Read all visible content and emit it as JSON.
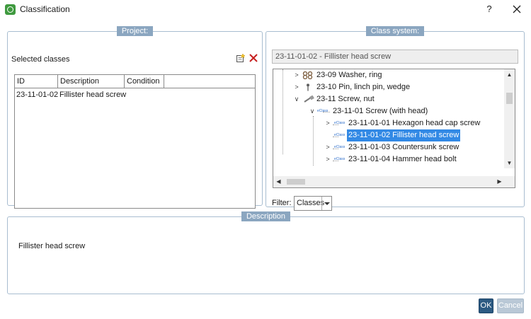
{
  "window": {
    "title": "Classification",
    "help_label": "?",
    "close_label": "close"
  },
  "project": {
    "legend": "Project:",
    "selected_classes_label": "Selected classes",
    "table": {
      "columns": [
        "ID",
        "Description",
        "Condition"
      ],
      "rows": [
        {
          "id": "23-11-01-02",
          "description": "Fillister head screw",
          "condition": ""
        }
      ]
    }
  },
  "class_system": {
    "legend": "Class system:",
    "current_path": "23-11-01-02 - Fillister head screw",
    "tree": [
      {
        "label": "23-09 Washer, ring",
        "icon": "washer-icon"
      },
      {
        "label": "23-10 Pin, linch pin, wedge",
        "icon": "pin-icon"
      },
      {
        "label": "23-11 Screw, nut",
        "icon": "screw-icon"
      },
      {
        "label": "23-11-01 Screw (with head)",
        "icon": "eclass-icon",
        "badge": "eClass"
      },
      {
        "label": "23-11-01-01 Hexagon head cap screw",
        "icon": "eclass-icon",
        "badge": "eClass"
      },
      {
        "label": "23-11-01-02 Fillister head screw",
        "icon": "eclass-icon",
        "badge": "eClass",
        "selected": true
      },
      {
        "label": "23-11-01-03 Countersunk screw",
        "icon": "eclass-icon",
        "badge": "eClass"
      },
      {
        "label": "23-11-01-04 Hammer head bolt",
        "icon": "eclass-icon",
        "badge": "eClass"
      }
    ],
    "filter_label": "Filter:",
    "filter_value": "Classes"
  },
  "description": {
    "legend": "Description",
    "text": "Fillister head screw"
  },
  "buttons": {
    "ok": "OK",
    "cancel": "Cancel"
  },
  "colors": {
    "group_border": "#a8bdd0",
    "legend_bg": "#8ba6c0",
    "selection": "#3289e5",
    "ok_button": "#2c5a82",
    "cancel_button": "#b9c8d6",
    "delete_icon": "#c62020"
  }
}
